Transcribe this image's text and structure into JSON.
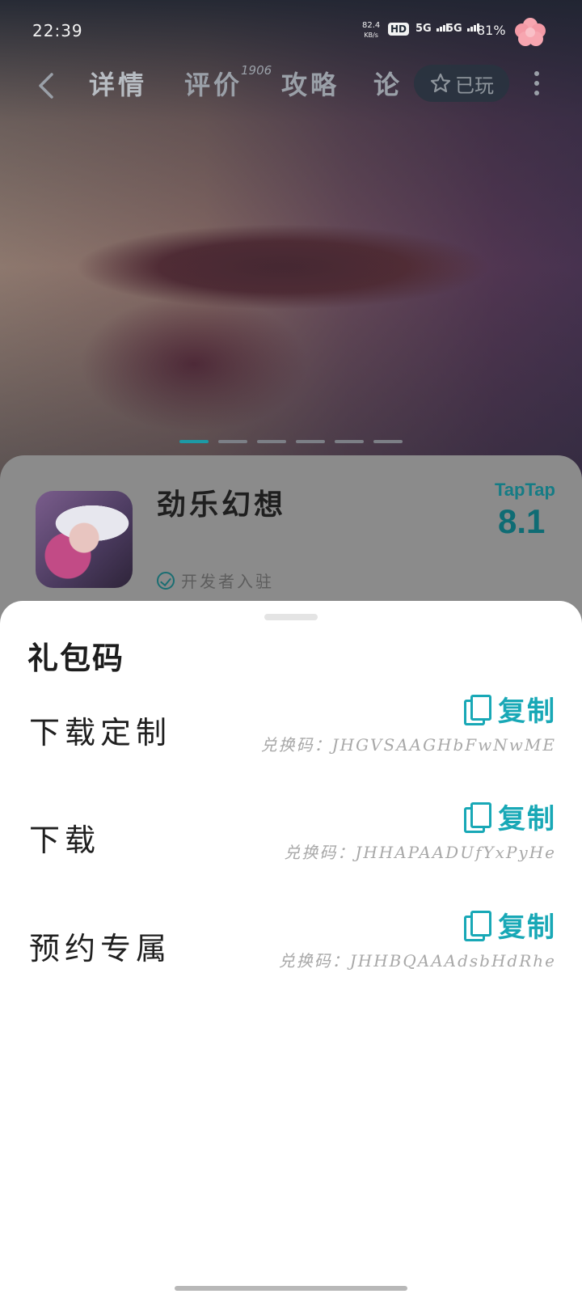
{
  "status_bar": {
    "time": "22:39",
    "net_speed_value": "82.4",
    "net_speed_unit": "KB/s",
    "hd_label": "HD",
    "signal1_label": "5G",
    "signal2_label": "5G",
    "battery": "81%"
  },
  "nav": {
    "tabs": [
      {
        "label": "详情"
      },
      {
        "label": "评价"
      },
      {
        "label": "攻略"
      },
      {
        "label": "论"
      }
    ],
    "review_count": "1906",
    "played_label": "已玩"
  },
  "carousel": {
    "count": 6,
    "active_index": 0
  },
  "game": {
    "title": "劲乐幻想",
    "developer_badge": "开发者入驻",
    "rating_brand": "TapTap",
    "rating_score": "8.1"
  },
  "sheet": {
    "title": "礼包码",
    "copy_label": "复制",
    "gifts": [
      {
        "name": "下载定制",
        "code": "兑换码：JHGVSAAGHbFwNwME"
      },
      {
        "name": "下载",
        "code": "兑换码：JHHAPAADUfYxPyHe"
      },
      {
        "name": "预约专属",
        "code": "兑换码：JHHBQAAAdsbHdRhe"
      }
    ]
  },
  "colors": {
    "accent": "#18a8b6",
    "score": "#0f6c74",
    "sheet_bg": "#ffffff"
  }
}
